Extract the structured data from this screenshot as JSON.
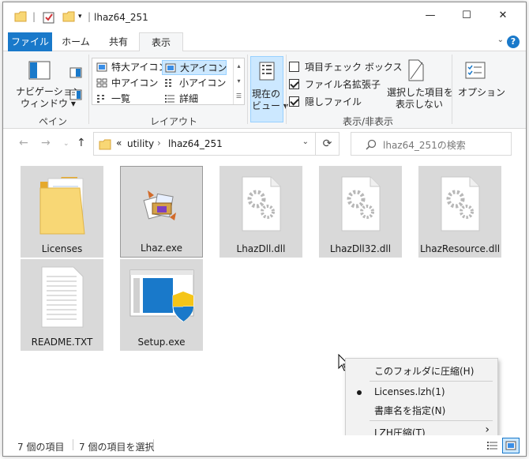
{
  "window": {
    "title": "lhaz64_251",
    "controls": {
      "minimize": "—",
      "maximize": "☐",
      "close": "✕"
    }
  },
  "tabs": [
    {
      "label": "ファイル"
    },
    {
      "label": "ホーム"
    },
    {
      "label": "共有"
    },
    {
      "label": "表示"
    }
  ],
  "ribbon": {
    "pane": {
      "navigation_pane": "ナビゲーション",
      "navigation_pane_2": "ウィンドウ",
      "group_label": "ペイン"
    },
    "layout": {
      "items": [
        "特大アイコン",
        "大アイコン",
        "中アイコン",
        "小アイコン",
        "一覧",
        "詳細"
      ],
      "selected": "大アイコン",
      "group_label": "レイアウト"
    },
    "current_view": {
      "line1": "現在の",
      "line2": "ビュー"
    },
    "show_hide": {
      "item_checkboxes": {
        "label": "項目チェック ボックス",
        "checked": false
      },
      "file_extensions": {
        "label": "ファイル名拡張子",
        "checked": true
      },
      "hidden_items": {
        "label": "隠しファイル",
        "checked": true
      },
      "hide_selected_line1": "選択した項目を",
      "hide_selected_line2": "表示しない",
      "group_label": "表示/非表示"
    },
    "options": "オプション"
  },
  "address": {
    "prefix": "«",
    "crumbs": [
      "utility",
      "lhaz64_251"
    ],
    "search_placeholder": "lhaz64_251の検索"
  },
  "files": [
    {
      "name": "Licenses",
      "icon": "folder-icon"
    },
    {
      "name": "Lhaz.exe",
      "icon": "lhaz-app-icon"
    },
    {
      "name": "LhazDll.dll",
      "icon": "dll-icon"
    },
    {
      "name": "LhazDll32.dll",
      "icon": "dll-icon"
    },
    {
      "name": "LhazResource.dll",
      "icon": "dll-icon"
    },
    {
      "name": "README.TXT",
      "icon": "text-file-icon"
    },
    {
      "name": "Setup.exe",
      "icon": "setup-icon"
    }
  ],
  "status": {
    "item_count": "7 個の項目",
    "selected_count": "7 個の項目を選択"
  },
  "context_menu": {
    "items": [
      {
        "label": "このフォルダに圧縮(H)"
      },
      {
        "label": "Licenses.lzh(1)",
        "checked": true
      },
      {
        "label": "書庫名を指定(N)"
      },
      {
        "label": "LZH圧縮(T)",
        "submenu_arrow": "›"
      }
    ]
  },
  "colors": {
    "accent": "#1979ca",
    "selection": "#cce8ff",
    "file_bg": "#d9d9d9"
  }
}
